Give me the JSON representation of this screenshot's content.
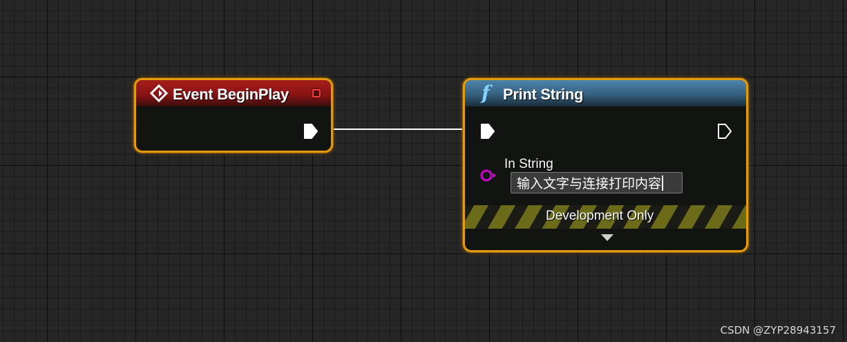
{
  "graph": {
    "nodes": {
      "begin_play": {
        "title": "Event BeginPlay",
        "header_color": "#9b1a1a",
        "icon": "event-diamond-icon",
        "delegate_pin_color": "#ff3b3b"
      },
      "print_string": {
        "title": "Print String",
        "header_color": "#3b6b8d",
        "icon": "function-f-icon",
        "icon_glyph": "f",
        "in_string_label": "In String",
        "in_string_value": "输入文字与连接打印内容",
        "in_string_pin_color": "#d000d0",
        "dev_banner_label": "Development Only",
        "expand_icon": "triangle-down-icon"
      }
    },
    "selection_outline_color": "#e39b0b",
    "wire_color": "#ffffff"
  },
  "watermark": "CSDN @ZYP28943157"
}
